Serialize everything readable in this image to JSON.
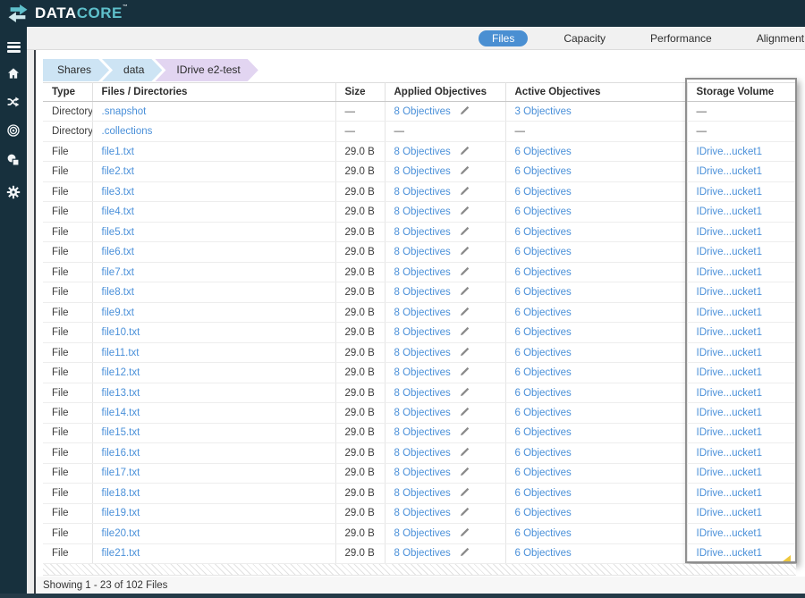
{
  "logo": {
    "text_primary": "DATA",
    "text_secondary": "CORE",
    "trademark": "™"
  },
  "tabs": [
    {
      "label": "Files",
      "active": true
    },
    {
      "label": "Capacity",
      "active": false
    },
    {
      "label": "Performance",
      "active": false
    },
    {
      "label": "Alignment",
      "active": false
    }
  ],
  "sidebar": {
    "items": [
      {
        "icon": "menu"
      },
      {
        "icon": "home"
      },
      {
        "icon": "data-movement"
      },
      {
        "icon": "objectives"
      },
      {
        "icon": "volumes"
      },
      {
        "icon": "settings"
      }
    ]
  },
  "breadcrumb": [
    {
      "label": "Shares",
      "current": false
    },
    {
      "label": "data",
      "current": false
    },
    {
      "label": "IDrive e2-test",
      "current": true
    }
  ],
  "table": {
    "columns": [
      "Type",
      "Files / Directories",
      "Size",
      "Applied Objectives",
      "Active Objectives",
      "Storage Volume"
    ],
    "rows": [
      {
        "type": "Directory",
        "name": ".snapshot",
        "size": "—",
        "applied": "8 Objectives",
        "edit": true,
        "active": "3 Objectives",
        "volume": "—"
      },
      {
        "type": "Directory",
        "name": ".collections",
        "size": "—",
        "applied": "—",
        "edit": false,
        "active": "—",
        "volume": "—"
      },
      {
        "type": "File",
        "name": "file1.txt",
        "size": "29.0 B",
        "applied": "8 Objectives",
        "edit": true,
        "active": "6 Objectives",
        "volume": "IDrive...ucket1"
      },
      {
        "type": "File",
        "name": "file2.txt",
        "size": "29.0 B",
        "applied": "8 Objectives",
        "edit": true,
        "active": "6 Objectives",
        "volume": "IDrive...ucket1"
      },
      {
        "type": "File",
        "name": "file3.txt",
        "size": "29.0 B",
        "applied": "8 Objectives",
        "edit": true,
        "active": "6 Objectives",
        "volume": "IDrive...ucket1"
      },
      {
        "type": "File",
        "name": "file4.txt",
        "size": "29.0 B",
        "applied": "8 Objectives",
        "edit": true,
        "active": "6 Objectives",
        "volume": "IDrive...ucket1"
      },
      {
        "type": "File",
        "name": "file5.txt",
        "size": "29.0 B",
        "applied": "8 Objectives",
        "edit": true,
        "active": "6 Objectives",
        "volume": "IDrive...ucket1"
      },
      {
        "type": "File",
        "name": "file6.txt",
        "size": "29.0 B",
        "applied": "8 Objectives",
        "edit": true,
        "active": "6 Objectives",
        "volume": "IDrive...ucket1"
      },
      {
        "type": "File",
        "name": "file7.txt",
        "size": "29.0 B",
        "applied": "8 Objectives",
        "edit": true,
        "active": "6 Objectives",
        "volume": "IDrive...ucket1"
      },
      {
        "type": "File",
        "name": "file8.txt",
        "size": "29.0 B",
        "applied": "8 Objectives",
        "edit": true,
        "active": "6 Objectives",
        "volume": "IDrive...ucket1"
      },
      {
        "type": "File",
        "name": "file9.txt",
        "size": "29.0 B",
        "applied": "8 Objectives",
        "edit": true,
        "active": "6 Objectives",
        "volume": "IDrive...ucket1"
      },
      {
        "type": "File",
        "name": "file10.txt",
        "size": "29.0 B",
        "applied": "8 Objectives",
        "edit": true,
        "active": "6 Objectives",
        "volume": "IDrive...ucket1"
      },
      {
        "type": "File",
        "name": "file11.txt",
        "size": "29.0 B",
        "applied": "8 Objectives",
        "edit": true,
        "active": "6 Objectives",
        "volume": "IDrive...ucket1"
      },
      {
        "type": "File",
        "name": "file12.txt",
        "size": "29.0 B",
        "applied": "8 Objectives",
        "edit": true,
        "active": "6 Objectives",
        "volume": "IDrive...ucket1"
      },
      {
        "type": "File",
        "name": "file13.txt",
        "size": "29.0 B",
        "applied": "8 Objectives",
        "edit": true,
        "active": "6 Objectives",
        "volume": "IDrive...ucket1"
      },
      {
        "type": "File",
        "name": "file14.txt",
        "size": "29.0 B",
        "applied": "8 Objectives",
        "edit": true,
        "active": "6 Objectives",
        "volume": "IDrive...ucket1"
      },
      {
        "type": "File",
        "name": "file15.txt",
        "size": "29.0 B",
        "applied": "8 Objectives",
        "edit": true,
        "active": "6 Objectives",
        "volume": "IDrive...ucket1"
      },
      {
        "type": "File",
        "name": "file16.txt",
        "size": "29.0 B",
        "applied": "8 Objectives",
        "edit": true,
        "active": "6 Objectives",
        "volume": "IDrive...ucket1"
      },
      {
        "type": "File",
        "name": "file17.txt",
        "size": "29.0 B",
        "applied": "8 Objectives",
        "edit": true,
        "active": "6 Objectives",
        "volume": "IDrive...ucket1"
      },
      {
        "type": "File",
        "name": "file18.txt",
        "size": "29.0 B",
        "applied": "8 Objectives",
        "edit": true,
        "active": "6 Objectives",
        "volume": "IDrive...ucket1"
      },
      {
        "type": "File",
        "name": "file19.txt",
        "size": "29.0 B",
        "applied": "8 Objectives",
        "edit": true,
        "active": "6 Objectives",
        "volume": "IDrive...ucket1"
      },
      {
        "type": "File",
        "name": "file20.txt",
        "size": "29.0 B",
        "applied": "8 Objectives",
        "edit": true,
        "active": "6 Objectives",
        "volume": "IDrive...ucket1"
      },
      {
        "type": "File",
        "name": "file21.txt",
        "size": "29.0 B",
        "applied": "8 Objectives",
        "edit": true,
        "active": "6 Objectives",
        "volume": "IDrive...ucket1"
      }
    ]
  },
  "footer": {
    "status": "Showing 1 - 23 of 102 Files"
  },
  "colors": {
    "brand_navy": "#17303d",
    "brand_teal": "#5fc0cb",
    "link_blue": "#4a90d9",
    "tab_active_bg": "#4a8fd2",
    "breadcrumb_blue": "#cde4f4",
    "breadcrumb_purple": "#e2d5f1",
    "highlight_border": "#8f8f8f"
  }
}
